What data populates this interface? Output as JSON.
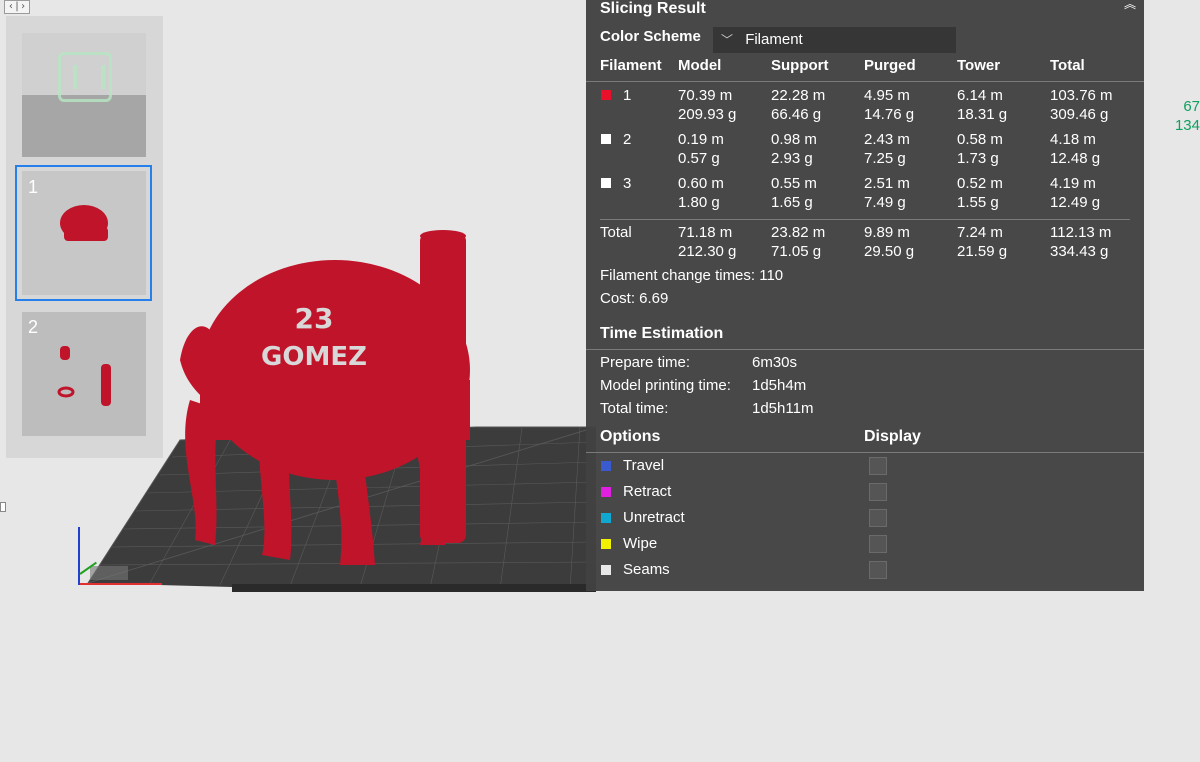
{
  "window": {
    "top_left_icon": "split-view-icon",
    "top_right_icon": "double-chevron-up-icon",
    "right_edge_values": [
      "67",
      "134"
    ],
    "right_edge_color": "#10a060"
  },
  "plates": [
    {
      "number": "",
      "thumbnail": "empty-plate"
    },
    {
      "number": "1",
      "thumbnail": "helmet-model",
      "selected": true
    },
    {
      "number": "2",
      "thumbnail": "parts-model"
    }
  ],
  "viewport": {
    "model_text_top": "23",
    "model_text_bottom": "GOMEZ",
    "model_color": "#c0142a"
  },
  "results": {
    "title": "Slicing Result",
    "color_scheme_label": "Color Scheme",
    "color_scheme_value": "Filament",
    "columns": [
      "Filament",
      "Model",
      "Support",
      "Purged",
      "Tower",
      "Total"
    ],
    "rows": [
      {
        "id": "1",
        "color": "#e8102a",
        "model": [
          "70.39 m",
          "209.93 g"
        ],
        "support": [
          "22.28 m",
          "66.46 g"
        ],
        "purged": [
          "4.95 m",
          "14.76 g"
        ],
        "tower": [
          "6.14 m",
          "18.31 g"
        ],
        "total": [
          "103.76 m",
          "309.46 g"
        ]
      },
      {
        "id": "2",
        "color": "#ffffff",
        "model": [
          "0.19 m",
          "0.57 g"
        ],
        "support": [
          "0.98 m",
          "2.93 g"
        ],
        "purged": [
          "2.43 m",
          "7.25 g"
        ],
        "tower": [
          "0.58 m",
          "1.73 g"
        ],
        "total": [
          "4.18 m",
          "12.48 g"
        ]
      },
      {
        "id": "3",
        "color": "#ffffff",
        "model": [
          "0.60 m",
          "1.80 g"
        ],
        "support": [
          "0.55 m",
          "1.65 g"
        ],
        "purged": [
          "2.51 m",
          "7.49 g"
        ],
        "tower": [
          "0.52 m",
          "1.55 g"
        ],
        "total": [
          "4.19 m",
          "12.49 g"
        ]
      }
    ],
    "total_row": {
      "label": "Total",
      "model": [
        "71.18 m",
        "212.30 g"
      ],
      "support": [
        "23.82 m",
        "71.05 g"
      ],
      "purged": [
        "9.89 m",
        "29.50 g"
      ],
      "tower": [
        "7.24 m",
        "21.59 g"
      ],
      "total": [
        "112.13 m",
        "334.43 g"
      ]
    },
    "filament_change": "Filament change times:  110",
    "cost": "Cost:  6.69",
    "time_title": "Time Estimation",
    "prepare_label": "Prepare time:",
    "prepare_value": "6m30s",
    "model_print_label": "Model printing time:",
    "model_print_value": "1d5h4m",
    "total_time_label": "Total time:",
    "total_time_value": "1d5h11m",
    "options_title": "Options",
    "display_title": "Display",
    "options": [
      {
        "label": "Travel",
        "color": "#3a5bd0"
      },
      {
        "label": "Retract",
        "color": "#e020e0"
      },
      {
        "label": "Unretract",
        "color": "#10a8d0"
      },
      {
        "label": "Wipe",
        "color": "#f0f000"
      },
      {
        "label": "Seams",
        "color": "#e8e8e8"
      }
    ]
  }
}
